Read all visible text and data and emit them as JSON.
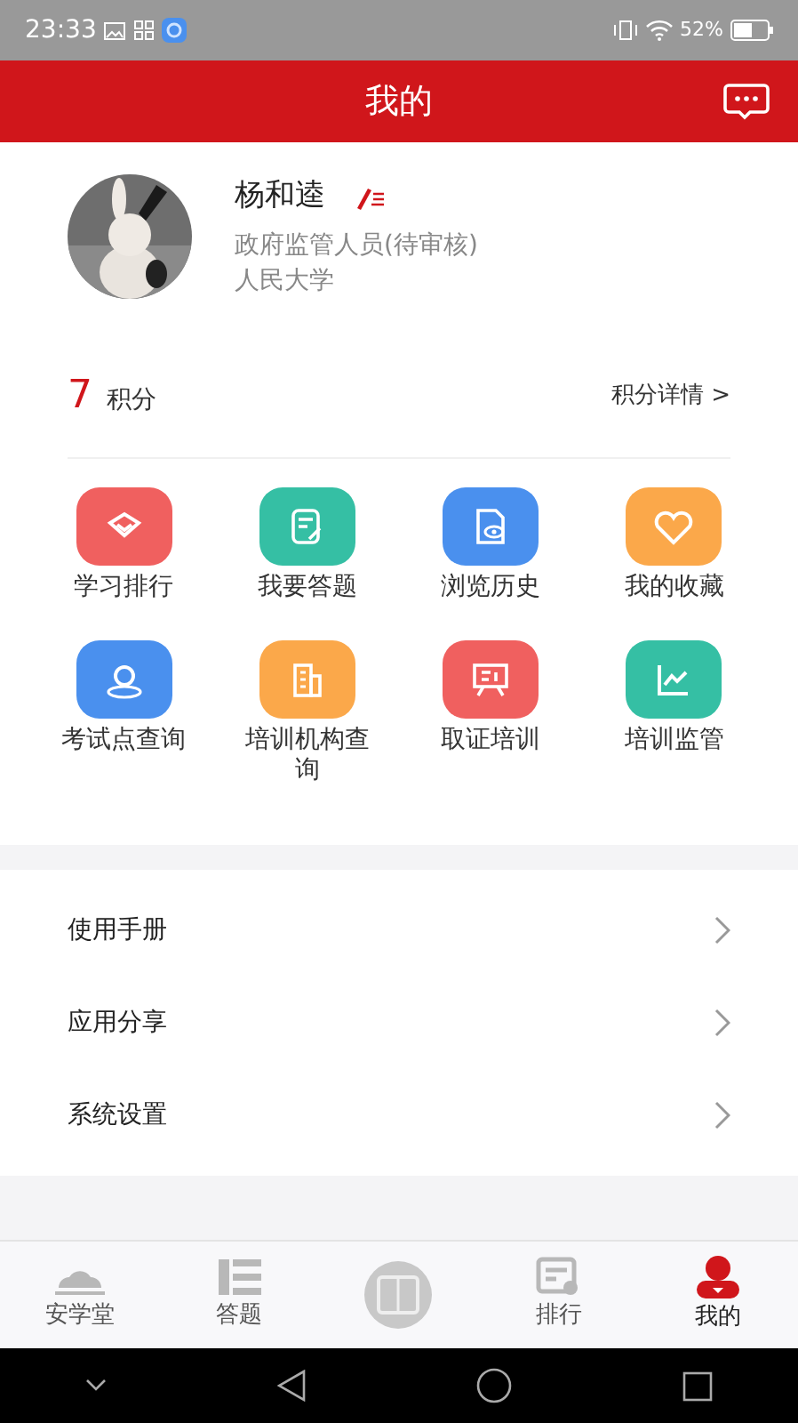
{
  "status_bar": {
    "time": "23:33",
    "battery": "52%"
  },
  "header": {
    "title": "我的"
  },
  "profile": {
    "name": "杨和逵",
    "role": "政府监管人员(待审核)",
    "school": "人民大学"
  },
  "points": {
    "value": "7",
    "label": "积分",
    "details": "积分详情 >"
  },
  "features": [
    {
      "label": "学习排行",
      "color": "#f0605f"
    },
    {
      "label": "我要答题",
      "color": "#35bfa4"
    },
    {
      "label": "浏览历史",
      "color": "#4a90ee"
    },
    {
      "label": "我的收藏",
      "color": "#fba84a"
    },
    {
      "label": "考试点查询",
      "color": "#4a90ee"
    },
    {
      "label": "培训机构查询",
      "color": "#fba84a"
    },
    {
      "label": "取证培训",
      "color": "#f0605f"
    },
    {
      "label": "培训监管",
      "color": "#35bfa4"
    }
  ],
  "menu": [
    {
      "label": "使用手册"
    },
    {
      "label": "应用分享"
    },
    {
      "label": "系统设置"
    }
  ],
  "tabs": [
    {
      "label": "安学堂",
      "selected": false
    },
    {
      "label": "答题",
      "selected": false
    },
    {
      "kind": "logo",
      "selected": false
    },
    {
      "label": "排行",
      "selected": false
    },
    {
      "label": "我的",
      "selected": true
    }
  ]
}
